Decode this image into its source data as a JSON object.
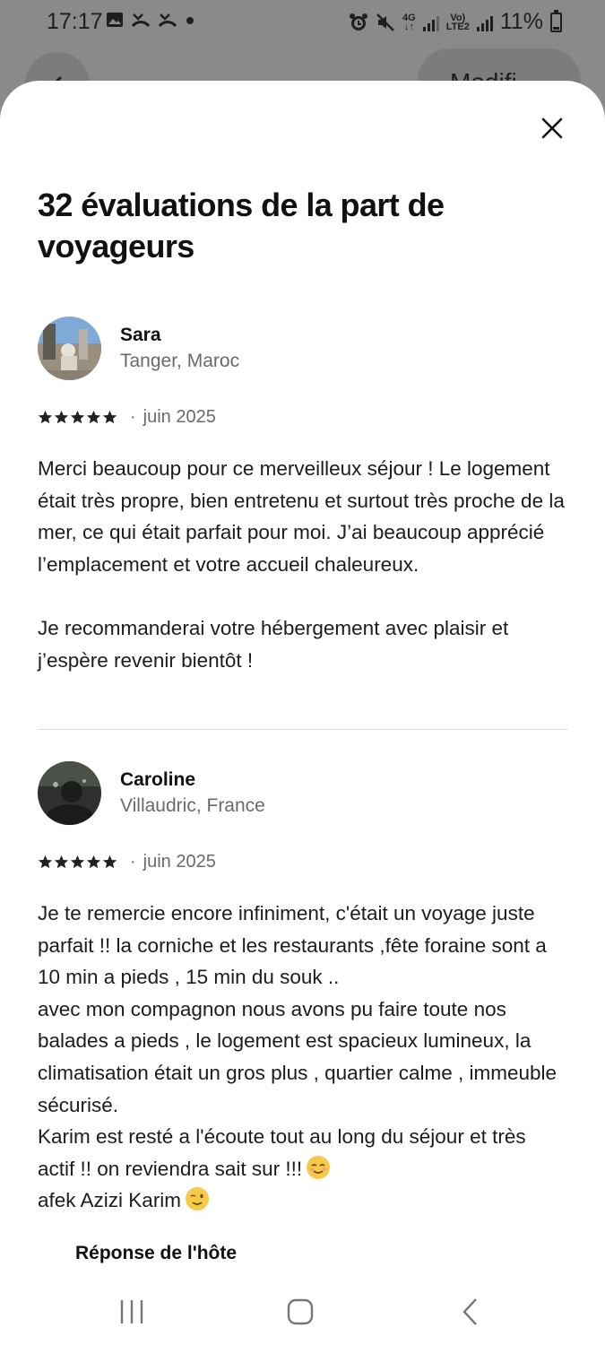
{
  "status_bar": {
    "time": "17:17",
    "battery": "11%",
    "network_4g": "4G",
    "network_volte": "Vo)",
    "network_lte2": "LTE2"
  },
  "background": {
    "modify_label": "Modifi"
  },
  "sheet": {
    "title": "32 évaluations de la part de voyageurs"
  },
  "reviews": [
    {
      "name": "Sara",
      "location": "Tanger, Maroc",
      "rating": 5,
      "separator": "·",
      "date": "juin 2025",
      "text": "Merci beaucoup pour ce merveilleux séjour ! Le logement était très propre, bien entretenu et surtout très proche de la mer, ce qui était parfait pour moi. J’ai beaucoup apprécié l’emplacement et votre accueil chaleureux.\n\nJe recommanderai votre hébergement avec plaisir et j’espère revenir bientôt !"
    },
    {
      "name": "Caroline",
      "location": "Villaudric, France",
      "rating": 5,
      "separator": "·",
      "date": "juin 2025",
      "text_part1": "Je te remercie encore infiniment, c'était un voyage juste parfait !! la corniche et les restaurants ,fête foraine sont a 10 min a pieds , 15 min du souk ..\navec mon compagnon nous avons pu faire toute nos balades a pieds , le logement est spacieux lumineux, la climatisation était un gros plus , quartier calme , immeuble sécurisé.\nKarim est resté a l'écoute tout au long du séjour et très actif !! on reviendra sait sur !!!",
      "text_part2": "afek Azizi Karim",
      "host_reply_label": "Réponse de l'hôte"
    }
  ],
  "colors": {
    "text_primary": "#111111",
    "text_secondary": "#6a6a6a",
    "divider": "#dddddd",
    "overlay": "#8a8a8a"
  }
}
